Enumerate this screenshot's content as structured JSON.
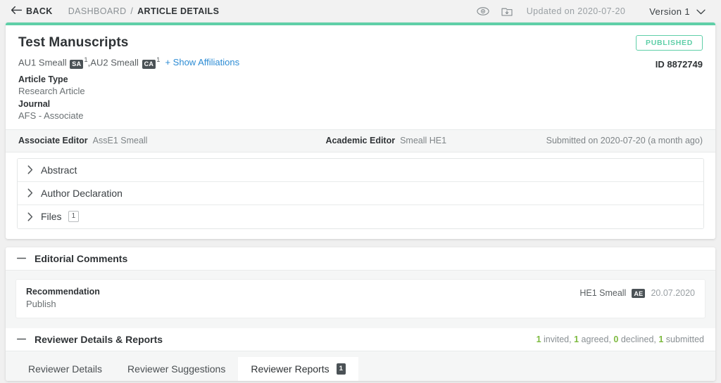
{
  "topbar": {
    "back_label": "BACK",
    "back_icon": "arrow-left-icon",
    "breadcrumb_parent": "DASHBOARD",
    "breadcrumb_separator": "/",
    "breadcrumb_current": "ARTICLE DETAILS",
    "preview_icon": "eye-icon",
    "download_icon": "folder-download-icon",
    "updated_text": "Updated on 2020-07-20",
    "version_label": "Version 1",
    "version_caret_icon": "chevron-down-icon"
  },
  "article": {
    "title": "Test Manuscripts",
    "authors": [
      {
        "name": "AU1 Smeall",
        "badge": "SA",
        "affiliation": "1",
        "trailing": ", "
      },
      {
        "name": "AU2 Smeall",
        "badge": "CA",
        "affiliation": "1",
        "trailing": ""
      }
    ],
    "show_affiliations": "+ Show Affiliations",
    "article_type_label": "Article Type",
    "article_type_value": "Research Article",
    "journal_label": "Journal",
    "journal_value": "AFS - Associate",
    "status": "PUBLISHED",
    "id_text": "ID 8872749",
    "accent_color": "#5fcfa8"
  },
  "editor_bar": {
    "associate_editor_label": "Associate Editor",
    "associate_editor_value": "AssE1 Smeall",
    "academic_editor_label": "Academic Editor",
    "academic_editor_value": "Smeall HE1",
    "submitted_text": "Submitted on 2020-07-20 (a month ago)"
  },
  "accordions": [
    {
      "label": "Abstract",
      "icon": "chevron-right-icon",
      "badge": ""
    },
    {
      "label": "Author Declaration",
      "icon": "chevron-right-icon",
      "badge": ""
    },
    {
      "label": "Files",
      "icon": "chevron-right-icon",
      "badge": "1"
    }
  ],
  "editorial_comments": {
    "title": "Editorial Comments",
    "collapse_icon": "minus-icon",
    "recommendation_label": "Recommendation",
    "recommendation_value": "Publish",
    "author": "HE1 Smeall",
    "author_badge": "AE",
    "date": "20.07.2020"
  },
  "reviewer_section": {
    "title": "Reviewer Details & Reports",
    "collapse_icon": "minus-icon",
    "stats": [
      {
        "count": "1",
        "label": " invited,"
      },
      {
        "count": "1",
        "label": " agreed,"
      },
      {
        "count": "0",
        "label": " declined,"
      },
      {
        "count": "1",
        "label": " submitted"
      }
    ],
    "stat_color": "#7dba3f",
    "tabs": [
      {
        "label": "Reviewer Details",
        "badge": "",
        "active": false
      },
      {
        "label": "Reviewer Suggestions",
        "badge": "",
        "active": false
      },
      {
        "label": "Reviewer Reports",
        "badge": "1",
        "active": true
      }
    ]
  }
}
